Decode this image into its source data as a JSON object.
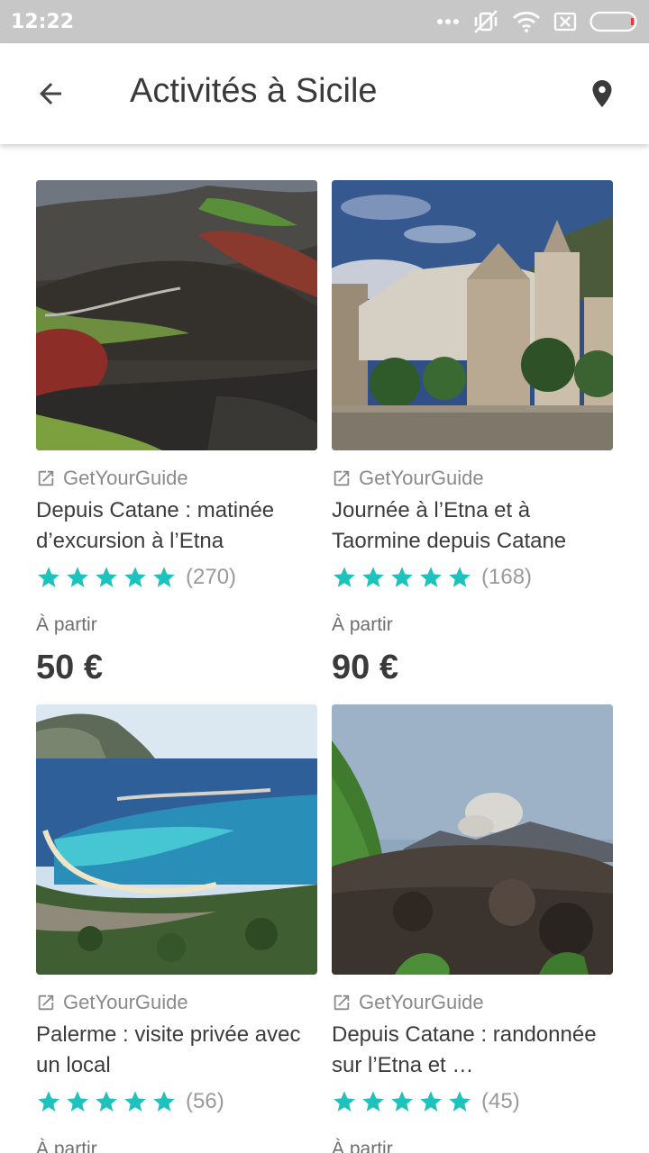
{
  "status_bar": {
    "time": "12:22"
  },
  "header": {
    "title": "Activités à Sicile"
  },
  "accent_color": "#1ec2bc",
  "activities": [
    {
      "provider": "GetYourGuide",
      "title": "Depuis Catane : matinée d’excursion à l’Etna",
      "rating": 5,
      "review_count": "(270)",
      "price_label": "À partir",
      "price": "50 €",
      "image": "etna-volcanic-landscape"
    },
    {
      "provider": "GetYourGuide",
      "title": "Journée à l’Etna et à Taormine depuis Catane",
      "rating": 5,
      "review_count": "(168)",
      "price_label": "À partir",
      "price": "90 €",
      "image": "taormina-square-church"
    },
    {
      "provider": "GetYourGuide",
      "title": "Palerme : visite privée avec un local",
      "rating": 5,
      "review_count": "(56)",
      "price_label": "À partir",
      "price": "",
      "image": "palermo-mondello-bay"
    },
    {
      "provider": "GetYourGuide",
      "title": "Depuis Catane : randonnée sur l’Etna et …",
      "rating": 5,
      "review_count": "(45)",
      "price_label": "À partir",
      "price": "",
      "image": "etna-lava-field"
    }
  ]
}
